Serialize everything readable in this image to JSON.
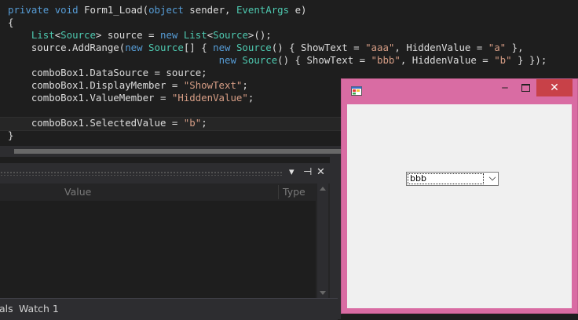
{
  "editor": {
    "lines": [
      [
        {
          "t": "private ",
          "c": "kw"
        },
        {
          "t": "void ",
          "c": "kw"
        },
        {
          "t": "Form1_Load(",
          "c": ""
        },
        {
          "t": "object ",
          "c": "kw"
        },
        {
          "t": "sender, ",
          "c": ""
        },
        {
          "t": "EventArgs ",
          "c": "ty"
        },
        {
          "t": "e)",
          "c": ""
        }
      ],
      [
        {
          "t": "{",
          "c": ""
        }
      ],
      [
        {
          "t": "    ",
          "c": ""
        },
        {
          "t": "List",
          "c": "ty"
        },
        {
          "t": "<",
          "c": ""
        },
        {
          "t": "Source",
          "c": "ty"
        },
        {
          "t": "> source = ",
          "c": ""
        },
        {
          "t": "new ",
          "c": "kw"
        },
        {
          "t": "List",
          "c": "ty"
        },
        {
          "t": "<",
          "c": ""
        },
        {
          "t": "Source",
          "c": "ty"
        },
        {
          "t": ">();",
          "c": ""
        }
      ],
      [
        {
          "t": "    source.AddRange(",
          "c": ""
        },
        {
          "t": "new ",
          "c": "kw"
        },
        {
          "t": "Source",
          "c": "ty"
        },
        {
          "t": "[] { ",
          "c": ""
        },
        {
          "t": "new ",
          "c": "kw"
        },
        {
          "t": "Source",
          "c": "ty"
        },
        {
          "t": "() { ShowText = ",
          "c": ""
        },
        {
          "t": "\"aaa\"",
          "c": "st"
        },
        {
          "t": ", HiddenValue = ",
          "c": ""
        },
        {
          "t": "\"a\"",
          "c": "st"
        },
        {
          "t": " },",
          "c": ""
        }
      ],
      [
        {
          "t": "                                    ",
          "c": ""
        },
        {
          "t": "new ",
          "c": "kw"
        },
        {
          "t": "Source",
          "c": "ty"
        },
        {
          "t": "() { ShowText = ",
          "c": ""
        },
        {
          "t": "\"bbb\"",
          "c": "st"
        },
        {
          "t": ", HiddenValue = ",
          "c": ""
        },
        {
          "t": "\"b\"",
          "c": "st"
        },
        {
          "t": " } });",
          "c": ""
        }
      ],
      [
        {
          "t": "    comboBox1.DataSource = source;",
          "c": ""
        }
      ],
      [
        {
          "t": "    comboBox1.DisplayMember = ",
          "c": ""
        },
        {
          "t": "\"ShowText\"",
          "c": "st"
        },
        {
          "t": ";",
          "c": ""
        }
      ],
      [
        {
          "t": "    comboBox1.ValueMember = ",
          "c": ""
        },
        {
          "t": "\"HiddenValue\"",
          "c": "st"
        },
        {
          "t": ";",
          "c": ""
        }
      ],
      [
        {
          "t": "",
          "c": ""
        }
      ],
      [
        {
          "t": "    comboBox1.SelectedValue = ",
          "c": ""
        },
        {
          "t": "\"b\"",
          "c": "st"
        },
        {
          "t": ";",
          "c": ""
        }
      ],
      [
        {
          "t": "}",
          "c": ""
        }
      ]
    ]
  },
  "watch_panel": {
    "header_buttons": {
      "dropdown": "▾",
      "pin": "⊣",
      "close": "✕"
    },
    "columns": {
      "value": "Value",
      "type": "Type"
    }
  },
  "bottom_tabs": {
    "locals": "als",
    "watch": "Watch 1"
  },
  "form": {
    "controls": {
      "minimize": "‒",
      "close": "✕"
    },
    "combo_value": "bbb"
  },
  "colors": {
    "form_border": "#d96ca3",
    "close_button": "#c84148",
    "keyword": "#569cd6",
    "type": "#4ec9b0",
    "string": "#d69d85"
  }
}
